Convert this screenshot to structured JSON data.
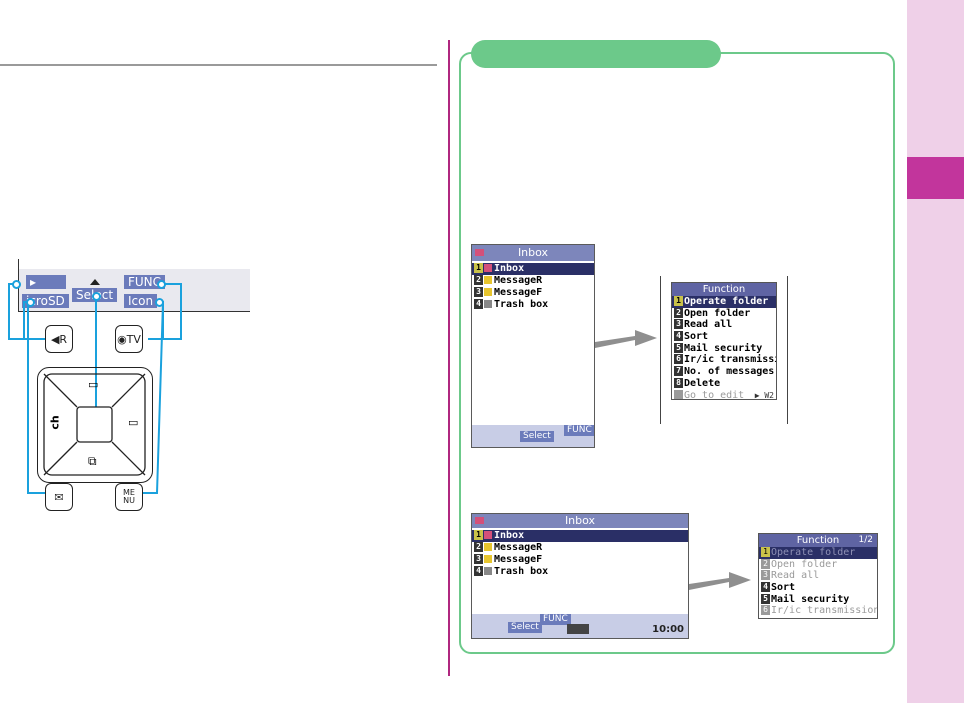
{
  "colors": {
    "accent_green": "#6cc98a",
    "side_strip": "#efd0e8",
    "side_tab": "#c2359c",
    "divider": "#b0277f",
    "softkey_blue": "#6b7bbb",
    "callout": "#1aa1dd"
  },
  "key_diagram": {
    "softkeys": {
      "top_left": "▸",
      "bottom_left": "icroSD",
      "center": "Select",
      "top_right": "FUNC",
      "bottom_right": "Icon"
    },
    "keys": {
      "left_upper": "◀R",
      "right_upper": "◉TV",
      "left_lower": "✉",
      "right_lower": "ME NU",
      "nav_up": "▭",
      "nav_left": "ch",
      "nav_right": "▭",
      "nav_down": "⧉"
    }
  },
  "screen1": {
    "title": "Inbox",
    "rows": [
      {
        "num": "1",
        "label": "Inbox"
      },
      {
        "num": "2",
        "label": "MessageR"
      },
      {
        "num": "3",
        "label": "MessageF"
      },
      {
        "num": "4",
        "label": "Trash box"
      }
    ],
    "select_label": "Select",
    "func_label": "FUNC"
  },
  "function1": {
    "title": "Function",
    "rows": [
      {
        "num": "1",
        "label": "Operate folder"
      },
      {
        "num": "2",
        "label": "Open folder"
      },
      {
        "num": "3",
        "label": "Read all"
      },
      {
        "num": "4",
        "label": "Sort"
      },
      {
        "num": "5",
        "label": "Mail security"
      },
      {
        "num": "6",
        "label": "Ir/ic transmission"
      },
      {
        "num": "7",
        "label": "No. of messages"
      },
      {
        "num": "8",
        "label": "Delete"
      },
      {
        "num": "",
        "label": "Go to edit"
      }
    ],
    "more_label": "▶ W2"
  },
  "screen2": {
    "title": "Inbox",
    "rows": [
      {
        "num": "1",
        "label": "Inbox"
      },
      {
        "num": "2",
        "label": "MessageR"
      },
      {
        "num": "3",
        "label": "MessageF"
      },
      {
        "num": "4",
        "label": "Trash box"
      }
    ],
    "select_label": "Select",
    "func_label": "FUNC",
    "clock": "10:00"
  },
  "function2": {
    "title": "Function",
    "page": "1/2",
    "rows": [
      {
        "num": "1",
        "label": "Operate folder"
      },
      {
        "num": "2",
        "label": "Open folder"
      },
      {
        "num": "3",
        "label": "Read all"
      },
      {
        "num": "4",
        "label": "Sort"
      },
      {
        "num": "5",
        "label": "Mail security"
      },
      {
        "num": "6",
        "label": "Ir/ic transmission"
      }
    ]
  }
}
